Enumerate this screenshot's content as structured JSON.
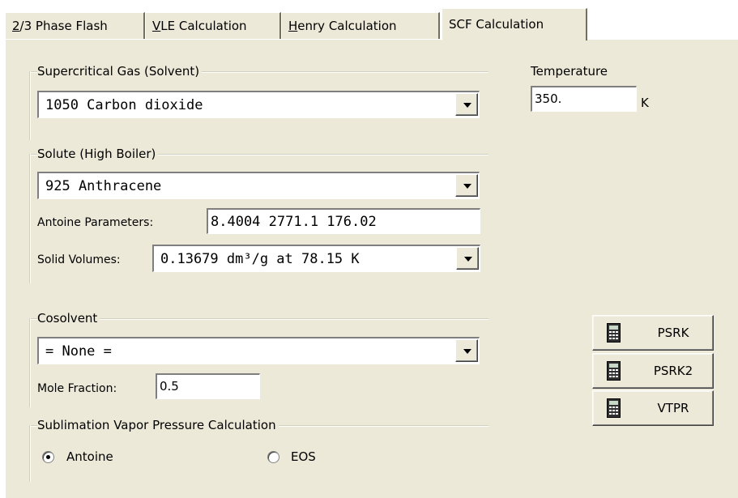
{
  "tabs": [
    {
      "prefix": "",
      "accel": "2",
      "rest": "/3 Phase Flash"
    },
    {
      "prefix": "",
      "accel": "V",
      "rest": "LE Calculation"
    },
    {
      "prefix": "",
      "accel": "H",
      "rest": "enry Calculation"
    },
    {
      "prefix": "",
      "accel": "",
      "rest": "SCF Calculation"
    }
  ],
  "supercritical": {
    "group_label": "Supercritical Gas (Solvent)",
    "value": "1050 Carbon dioxide"
  },
  "temperature": {
    "label": "Temperature",
    "value": "350.",
    "unit": "K"
  },
  "solute": {
    "group_label": "Solute (High Boiler)",
    "value": "925 Anthracene",
    "antoine_label": "Antoine Parameters:",
    "antoine_value": "8.4004 2771.1 176.02",
    "solid_label": "Solid Volumes:",
    "solid_value": "0.13679 dm³/g at 78.15 K"
  },
  "cosolvent": {
    "group_label": "Cosolvent",
    "value": "= None =",
    "mole_label": "Mole Fraction:",
    "mole_value": "0.5"
  },
  "sublimation": {
    "group_label": "Sublimation Vapor Pressure Calculation",
    "options": [
      {
        "label": "Antoine",
        "selected": true
      },
      {
        "label": "EOS",
        "selected": false
      }
    ]
  },
  "buttons": {
    "psrk": "PSRK",
    "psrk2": "PSRK2",
    "vtpr": "VTPR"
  }
}
